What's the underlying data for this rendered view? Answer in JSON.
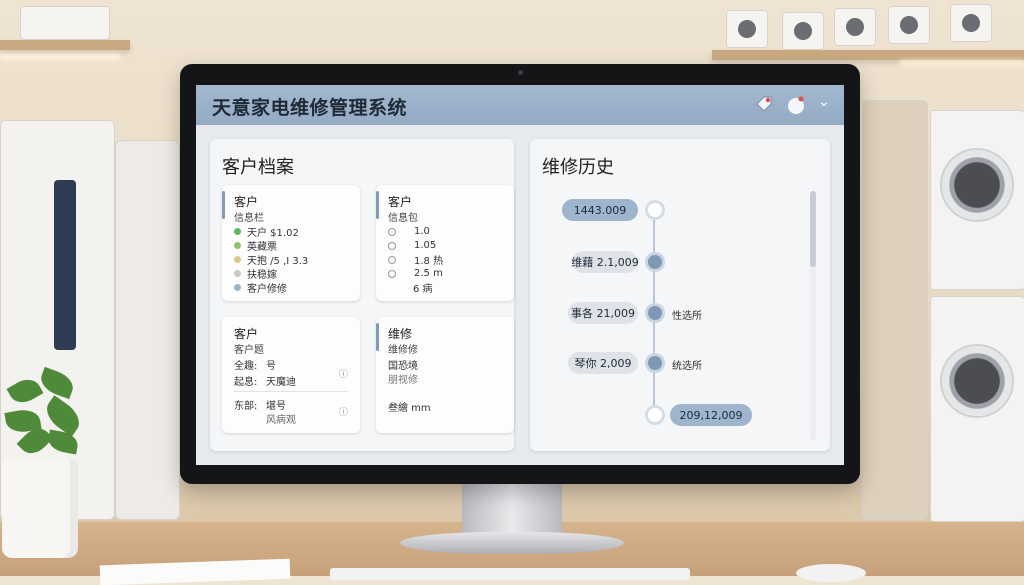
{
  "app": {
    "title": "天意家电维修管理系统"
  },
  "topbar_icons": [
    "tag-icon",
    "avatar-icon",
    "chevron-down-icon"
  ],
  "customer_panel": {
    "title": "客户档案",
    "card1": {
      "heading": "客户",
      "subheading": "信息栏",
      "rows": [
        {
          "label": "天户 $1.02",
          "dot": "#5cb85c"
        },
        {
          "label": "英藏票",
          "dot": "#8fc56a"
        },
        {
          "label": "天抱 /5 ,I 3.3",
          "dot": "#d8c98a"
        },
        {
          "label": "扶稳嫁",
          "dot": "#c9c9c9"
        },
        {
          "label": "客户修修",
          "dot": "#9fb2c7"
        }
      ]
    },
    "card2": {
      "heading": "客户",
      "subheading": "信息包",
      "rows": [
        "1.0",
        "1.05",
        "1.8 热",
        "2.5 m",
        "6 病"
      ]
    },
    "card3": {
      "heading": "客户",
      "subheading": "客户题",
      "kv": [
        {
          "k": "全趣:",
          "v": "号"
        },
        {
          "k": "起息:",
          "v": "天魔迪"
        },
        {
          "k": "东部:",
          "v": "堪号"
        }
      ],
      "extra": "风病观"
    },
    "card4": {
      "heading": "维修",
      "subheading": "维修修",
      "rows": [
        "国恐境",
        "朋视修"
      ],
      "footer": "叁繪 mm"
    }
  },
  "history_panel": {
    "title": "维修历史",
    "entries": [
      {
        "date": "1443.009",
        "note": ""
      },
      {
        "date": "维藉 2.1,009",
        "note": ""
      },
      {
        "date": "事各 21,009",
        "note": "性选所"
      },
      {
        "date": "琴你 2,009",
        "note": "统选所"
      },
      {
        "date": "209,12,009",
        "note": ""
      }
    ]
  }
}
